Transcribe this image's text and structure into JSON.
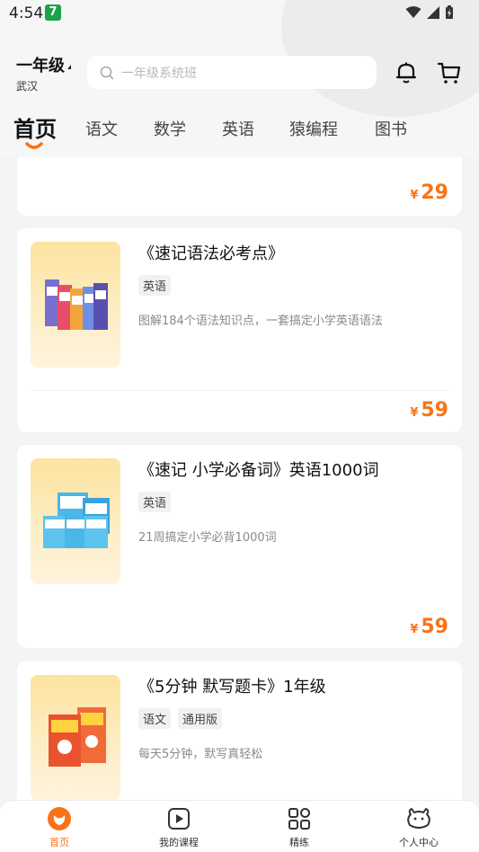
{
  "status": {
    "time": "4:54",
    "app_badge": "7"
  },
  "header": {
    "grade": "一年级",
    "city": "武汉",
    "search_placeholder": "一年级系统班"
  },
  "tabs": [
    "首页",
    "语文",
    "数学",
    "英语",
    "猿编程",
    "图书"
  ],
  "products": [
    {
      "price_symbol": "¥",
      "price": "29"
    },
    {
      "title": "《速记语法必考点》",
      "tags": [
        "英语"
      ],
      "desc": "图解184个语法知识点，一套搞定小学英语语法",
      "price_symbol": "¥",
      "price": "59"
    },
    {
      "title": "《速记 小学必备词》英语1000词",
      "tags": [
        "英语"
      ],
      "desc": "21周搞定小学必背1000词",
      "price_symbol": "¥",
      "price": "59"
    },
    {
      "title": "《5分钟 默写题卡》1年级",
      "tags": [
        "语文",
        "通用版"
      ],
      "desc": "每天5分钟，默写真轻松"
    }
  ],
  "bottom_nav": [
    {
      "label": "首页",
      "icon": "home-icon",
      "active": true
    },
    {
      "label": "我的课程",
      "icon": "play-icon",
      "active": false
    },
    {
      "label": "精练",
      "icon": "grid-icon",
      "active": false
    },
    {
      "label": "个人中心",
      "icon": "profile-icon",
      "active": false
    }
  ],
  "colors": {
    "accent": "#f97316",
    "thumb_bg": "#fde3a0"
  }
}
